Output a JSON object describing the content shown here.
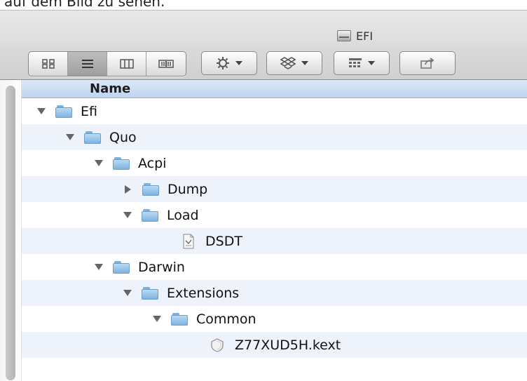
{
  "page_top_text": "auf dem Bild zu sehen.",
  "window": {
    "title": "EFI",
    "title_icon": "drive-icon"
  },
  "toolbar": {
    "view_modes": [
      {
        "name": "icon-view",
        "icon": "icon-grid-icon",
        "active": false
      },
      {
        "name": "list-view",
        "icon": "list-lines-icon",
        "active": true
      },
      {
        "name": "column-view",
        "icon": "columns-icon",
        "active": false
      },
      {
        "name": "coverflow-view",
        "icon": "coverflow-icon",
        "active": false
      }
    ],
    "buttons": [
      {
        "name": "action-menu-button",
        "icon": "gear-icon"
      },
      {
        "name": "dropbox-menu-button",
        "icon": "dropbox-icon"
      },
      {
        "name": "arrange-menu-button",
        "icon": "arrange-grid-icon"
      },
      {
        "name": "share-button",
        "icon": "share-icon"
      }
    ]
  },
  "list": {
    "column_header": "Name",
    "items": [
      {
        "label": "Efi",
        "type": "folder",
        "expanded": true
      },
      {
        "label": "Quo",
        "type": "folder",
        "expanded": true
      },
      {
        "label": "Acpi",
        "type": "folder",
        "expanded": true
      },
      {
        "label": "Dump",
        "type": "folder",
        "expanded": false
      },
      {
        "label": "Load",
        "type": "folder",
        "expanded": true
      },
      {
        "label": "DSDT",
        "type": "file"
      },
      {
        "label": "Darwin",
        "type": "folder",
        "expanded": true
      },
      {
        "label": "Extensions",
        "type": "folder",
        "expanded": true
      },
      {
        "label": "Common",
        "type": "folder",
        "expanded": true
      },
      {
        "label": "Z77XUD5H.kext",
        "type": "kext"
      }
    ]
  },
  "colors": {
    "header_blue": "#c5d8f1",
    "row_alt": "#eef3fb",
    "folder_blue": "#8cc0ea"
  }
}
